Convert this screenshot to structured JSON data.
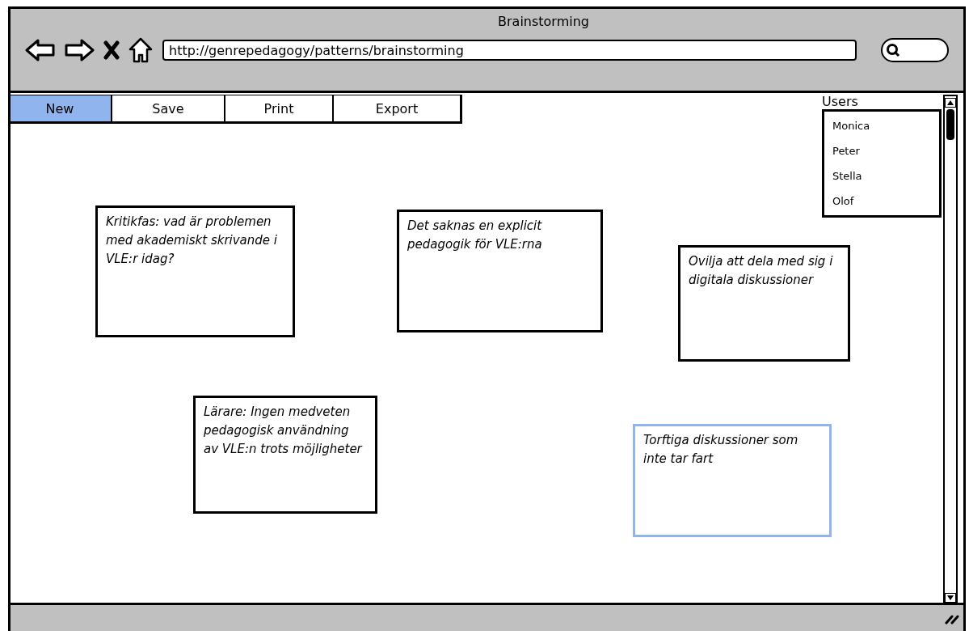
{
  "window": {
    "title": "Brainstorming"
  },
  "address_bar": {
    "value": "http://genrepedagogy/patterns/brainstorming"
  },
  "toolbar": [
    {
      "label": "New",
      "selected": true
    },
    {
      "label": "Save",
      "selected": false
    },
    {
      "label": "Print",
      "selected": false
    },
    {
      "label": "Export",
      "selected": false
    }
  ],
  "users": {
    "label": "Users",
    "items": [
      "Monica",
      "Peter",
      "Stella",
      "Olof"
    ]
  },
  "notes": [
    {
      "text": "Kritikfas: vad är problemen med akademiskt skrivande i VLE:r idag?",
      "selected": false
    },
    {
      "text": "Det saknas en explicit pedagogik för VLE:rna",
      "selected": false
    },
    {
      "text": "Ovilja att dela med sig i digitala diskussioner",
      "selected": false
    },
    {
      "text": "Lärare: Ingen medveten pedagogisk användning av VLE:n trots möjligheter",
      "selected": false
    },
    {
      "text": "Torftiga diskussioner som inte tar fart",
      "selected": true
    }
  ]
}
